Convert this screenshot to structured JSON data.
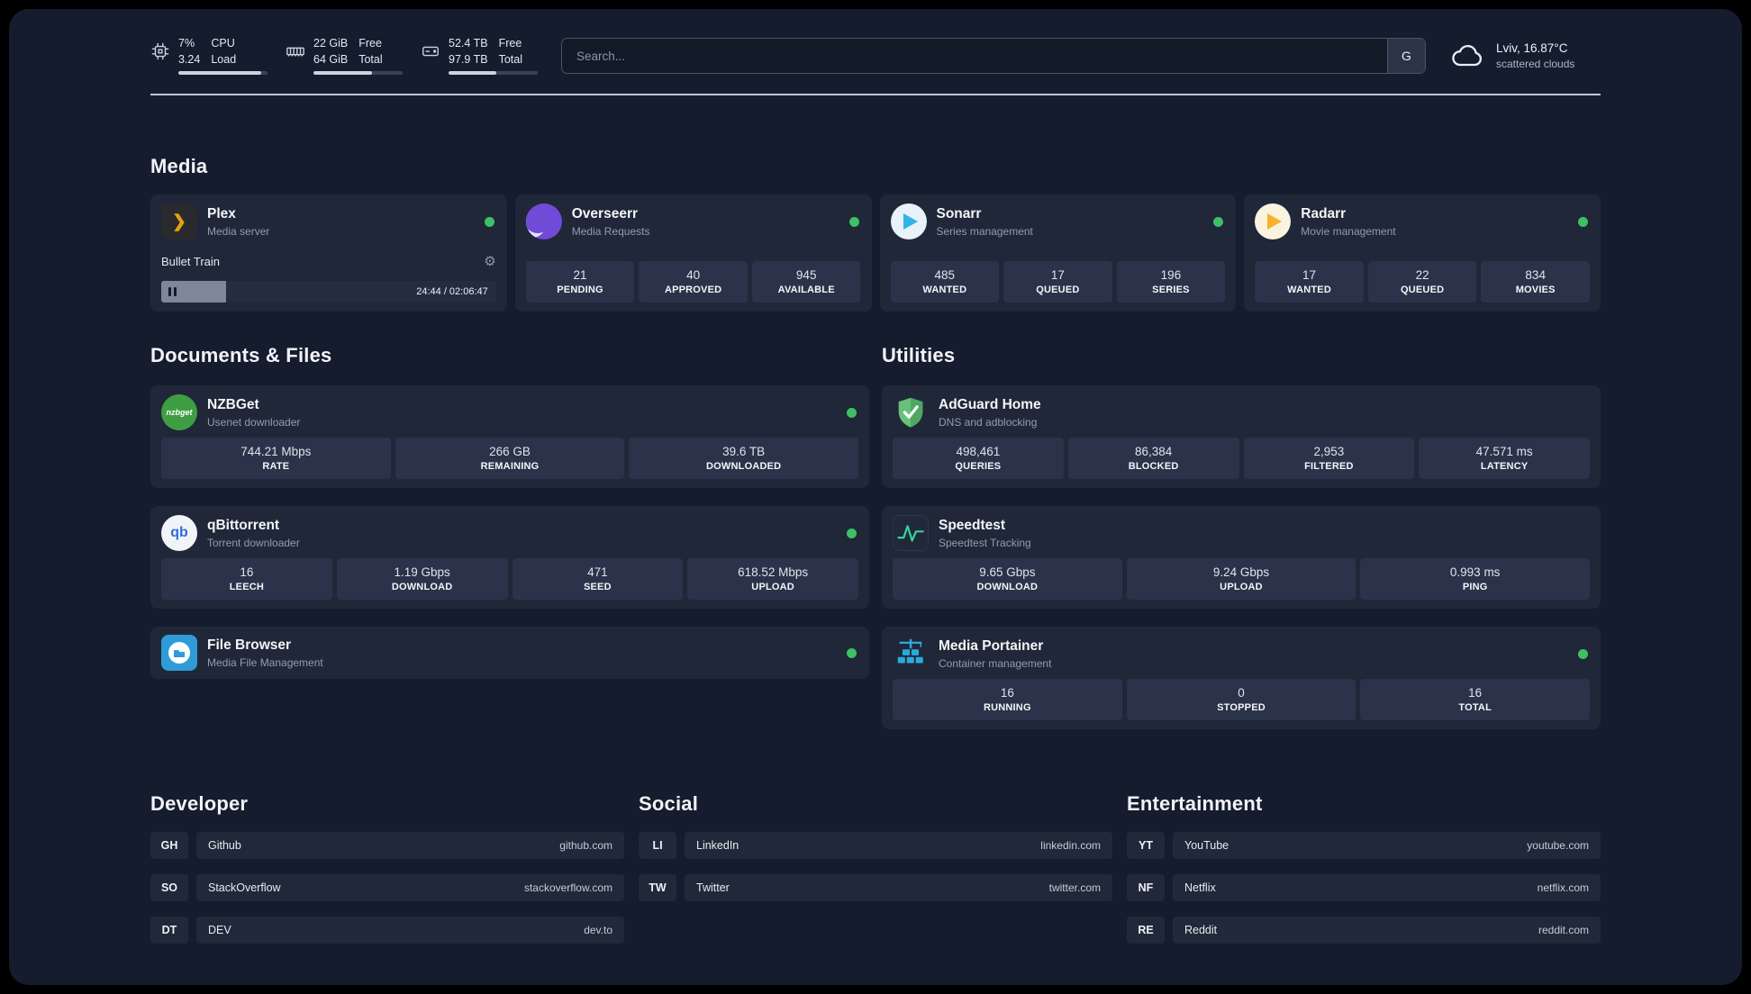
{
  "topbar": {
    "cpu": {
      "icon": "cpu-chip-icon",
      "top_value": "7%",
      "bottom_value": "3.24",
      "top_label": "CPU",
      "bottom_label": "Load",
      "bar_pct": 93
    },
    "ram": {
      "icon": "memory-icon",
      "top_value": "22 GiB",
      "bottom_value": "64 GiB",
      "top_label": "Free",
      "bottom_label": "Total",
      "bar_pct": 66
    },
    "disk": {
      "icon": "hard-drive-icon",
      "top_value": "52.4 TB",
      "bottom_value": "97.9 TB",
      "top_label": "Free",
      "bottom_label": "Total",
      "bar_pct": 54
    },
    "search": {
      "placeholder": "Search...",
      "engine_button": "G"
    },
    "weather": {
      "icon": "cloud-icon",
      "location": "Lviv, 16.87°C",
      "condition": "scattered clouds"
    }
  },
  "section_titles": {
    "media": "Media",
    "documents": "Documents & Files",
    "utilities": "Utilities",
    "developer": "Developer",
    "social": "Social",
    "entertainment": "Entertainment"
  },
  "glyphs": {
    "plex_chevron": "❯",
    "gear": "⚙",
    "nzbget": "nzbget",
    "qbittorrent": "qb"
  },
  "apps": {
    "plex": {
      "name": "Plex",
      "subtitle": "Media server",
      "now_playing": "Bullet Train",
      "time": "24:44 / 02:06:47",
      "progress_pct": 19.5
    },
    "overseerr": {
      "name": "Overseerr",
      "subtitle": "Media Requests",
      "stats": [
        {
          "value": "21",
          "label": "PENDING"
        },
        {
          "value": "40",
          "label": "APPROVED"
        },
        {
          "value": "945",
          "label": "AVAILABLE"
        }
      ]
    },
    "sonarr": {
      "name": "Sonarr",
      "subtitle": "Series management",
      "stats": [
        {
          "value": "485",
          "label": "WANTED"
        },
        {
          "value": "17",
          "label": "QUEUED"
        },
        {
          "value": "196",
          "label": "SERIES"
        }
      ]
    },
    "radarr": {
      "name": "Radarr",
      "subtitle": "Movie management",
      "stats": [
        {
          "value": "17",
          "label": "WANTED"
        },
        {
          "value": "22",
          "label": "QUEUED"
        },
        {
          "value": "834",
          "label": "MOVIES"
        }
      ]
    },
    "nzbget": {
      "name": "NZBGet",
      "subtitle": "Usenet downloader",
      "stats": [
        {
          "value": "744.21 Mbps",
          "label": "RATE"
        },
        {
          "value": "266 GB",
          "label": "REMAINING"
        },
        {
          "value": "39.6 TB",
          "label": "DOWNLOADED"
        }
      ]
    },
    "qbittorrent": {
      "name": "qBittorrent",
      "subtitle": "Torrent downloader",
      "stats": [
        {
          "value": "16",
          "label": "LEECH"
        },
        {
          "value": "1.19 Gbps",
          "label": "DOWNLOAD"
        },
        {
          "value": "471",
          "label": "SEED"
        },
        {
          "value": "618.52 Mbps",
          "label": "UPLOAD"
        }
      ]
    },
    "filebrowser": {
      "name": "File Browser",
      "subtitle": "Media File Management"
    },
    "adguard": {
      "name": "AdGuard Home",
      "subtitle": "DNS and adblocking",
      "stats": [
        {
          "value": "498,461",
          "label": "QUERIES"
        },
        {
          "value": "86,384",
          "label": "BLOCKED"
        },
        {
          "value": "2,953",
          "label": "FILTERED"
        },
        {
          "value": "47.571 ms",
          "label": "LATENCY"
        }
      ]
    },
    "speedtest": {
      "name": "Speedtest",
      "subtitle": "Speedtest Tracking",
      "stats": [
        {
          "value": "9.65 Gbps",
          "label": "DOWNLOAD"
        },
        {
          "value": "9.24 Gbps",
          "label": "UPLOAD"
        },
        {
          "value": "0.993 ms",
          "label": "PING"
        }
      ]
    },
    "portainer": {
      "name": "Media Portainer",
      "subtitle": "Container management",
      "stats": [
        {
          "value": "16",
          "label": "RUNNING"
        },
        {
          "value": "0",
          "label": "STOPPED"
        },
        {
          "value": "16",
          "label": "TOTAL"
        }
      ]
    }
  },
  "bookmarks": {
    "developer": [
      {
        "abbr": "GH",
        "name": "Github",
        "url": "github.com"
      },
      {
        "abbr": "SO",
        "name": "StackOverflow",
        "url": "stackoverflow.com"
      },
      {
        "abbr": "DT",
        "name": "DEV",
        "url": "dev.to"
      }
    ],
    "social": [
      {
        "abbr": "LI",
        "name": "LinkedIn",
        "url": "linkedin.com"
      },
      {
        "abbr": "TW",
        "name": "Twitter",
        "url": "twitter.com"
      }
    ],
    "entertainment": [
      {
        "abbr": "YT",
        "name": "YouTube",
        "url": "youtube.com"
      },
      {
        "abbr": "NF",
        "name": "Netflix",
        "url": "netflix.com"
      },
      {
        "abbr": "RE",
        "name": "Reddit",
        "url": "reddit.com"
      }
    ]
  },
  "colors": {
    "panel_bg": "#151c2e",
    "card_bg": "#1f2738",
    "tile_bg": "#2a3349",
    "status_online": "#3fbf66",
    "plex_accent": "#e5a00d",
    "sonarr_accent": "#30b3e8",
    "radarr_accent": "#f6b32b",
    "adguard_accent": "#68c07a",
    "portainer_accent": "#29aadf",
    "speedtest_accent": "#36d399"
  }
}
